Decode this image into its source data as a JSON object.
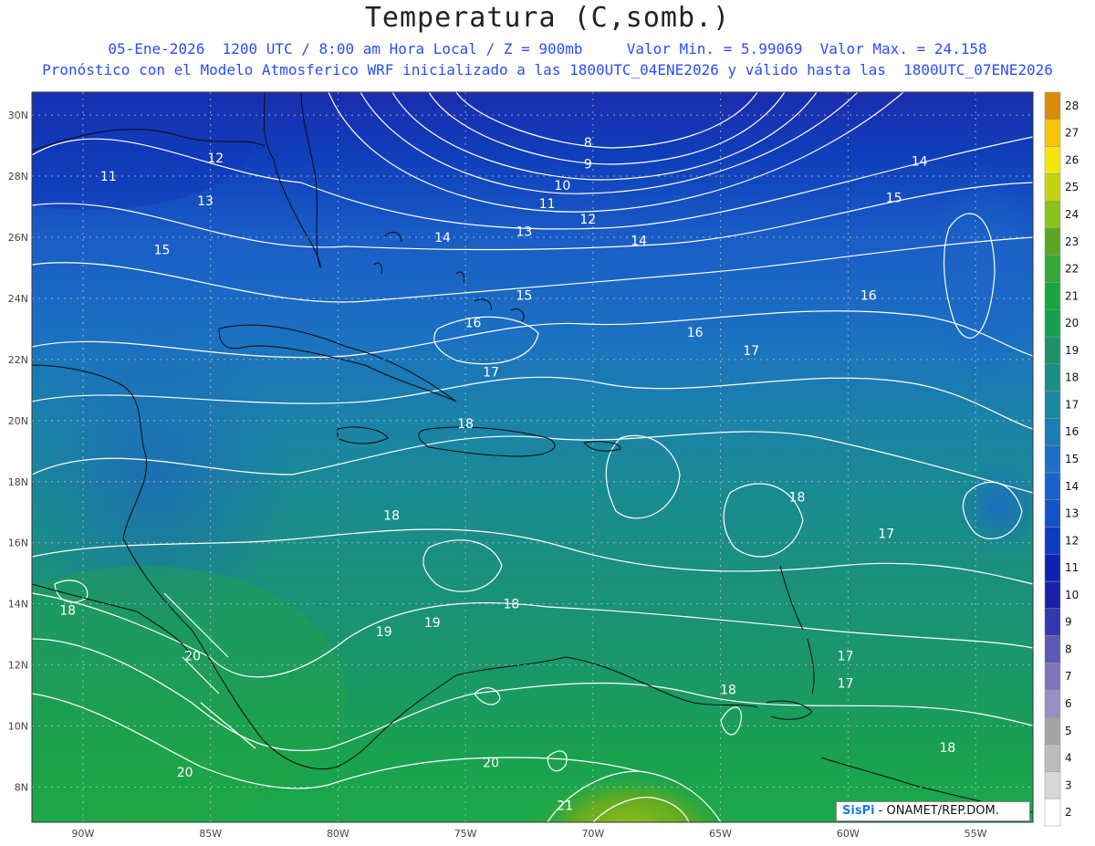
{
  "header": {
    "title": "Temperatura (C,somb.)",
    "line1": "05-Ene-2026  1200 UTC / 8:00 am Hora Local / Z = 900mb     Valor Min. = 5.99069  Valor Max. = 24.158",
    "line2": "Pronóstico con el Modelo Atmosferico WRF inicializado a las 1800UTC_04ENE2026 y válido hasta las  1800UTC_07ENE2026"
  },
  "map": {
    "lon_range": [
      -92,
      -52.75
    ],
    "lat_range": [
      6.85,
      30.75
    ],
    "lon_ticks": [
      {
        "value": -90,
        "label": "90W"
      },
      {
        "value": -85,
        "label": "85W"
      },
      {
        "value": -80,
        "label": "80W"
      },
      {
        "value": -75,
        "label": "75W"
      },
      {
        "value": -70,
        "label": "70W"
      },
      {
        "value": -65,
        "label": "65W"
      },
      {
        "value": -60,
        "label": "60W"
      },
      {
        "value": -55,
        "label": "55W"
      }
    ],
    "lat_ticks": [
      {
        "value": 30,
        "label": "30N"
      },
      {
        "value": 28,
        "label": "28N"
      },
      {
        "value": 26,
        "label": "26N"
      },
      {
        "value": 24,
        "label": "24N"
      },
      {
        "value": 22,
        "label": "22N"
      },
      {
        "value": 20,
        "label": "20N"
      },
      {
        "value": 18,
        "label": "18N"
      },
      {
        "value": 16,
        "label": "16N"
      },
      {
        "value": 14,
        "label": "14N"
      },
      {
        "value": 12,
        "label": "12N"
      },
      {
        "value": 10,
        "label": "10N"
      },
      {
        "value": 8,
        "label": "8N"
      }
    ],
    "contour_labels": [
      {
        "value": "8",
        "lon": -70.2,
        "lat": 29.1
      },
      {
        "value": "9",
        "lon": -70.2,
        "lat": 28.4
      },
      {
        "value": "10",
        "lon": -71.2,
        "lat": 27.7
      },
      {
        "value": "11",
        "lon": -71.8,
        "lat": 27.1
      },
      {
        "value": "12",
        "lon": -70.2,
        "lat": 26.6
      },
      {
        "value": "13",
        "lon": -72.7,
        "lat": 26.2
      },
      {
        "value": "14",
        "lon": -68.2,
        "lat": 25.9
      },
      {
        "value": "14",
        "lon": -75.9,
        "lat": 26.0
      },
      {
        "value": "11",
        "lon": -89.0,
        "lat": 28.0
      },
      {
        "value": "12",
        "lon": -84.8,
        "lat": 28.6
      },
      {
        "value": "13",
        "lon": -85.2,
        "lat": 27.2
      },
      {
        "value": "15",
        "lon": -86.9,
        "lat": 25.6
      },
      {
        "value": "14",
        "lon": -57.2,
        "lat": 28.5
      },
      {
        "value": "15",
        "lon": -58.2,
        "lat": 27.3
      },
      {
        "value": "15",
        "lon": -72.7,
        "lat": 24.1
      },
      {
        "value": "16",
        "lon": -74.7,
        "lat": 23.2
      },
      {
        "value": "16",
        "lon": -66.0,
        "lat": 22.9
      },
      {
        "value": "16",
        "lon": -59.2,
        "lat": 24.1
      },
      {
        "value": "17",
        "lon": -63.8,
        "lat": 22.3
      },
      {
        "value": "17",
        "lon": -74.0,
        "lat": 21.6
      },
      {
        "value": "18",
        "lon": -75.0,
        "lat": 19.9
      },
      {
        "value": "18",
        "lon": -77.9,
        "lat": 16.9
      },
      {
        "value": "18",
        "lon": -62.0,
        "lat": 17.5
      },
      {
        "value": "17",
        "lon": -58.5,
        "lat": 16.3
      },
      {
        "value": "18",
        "lon": -90.6,
        "lat": 13.8
      },
      {
        "value": "18",
        "lon": -73.2,
        "lat": 14.0
      },
      {
        "value": "19",
        "lon": -78.2,
        "lat": 13.1
      },
      {
        "value": "19",
        "lon": -76.3,
        "lat": 13.4
      },
      {
        "value": "20",
        "lon": -85.7,
        "lat": 12.3
      },
      {
        "value": "17",
        "lon": -60.1,
        "lat": 12.3
      },
      {
        "value": "17",
        "lon": -60.1,
        "lat": 11.4
      },
      {
        "value": "18",
        "lon": -64.7,
        "lat": 11.2
      },
      {
        "value": "18",
        "lon": -56.1,
        "lat": 9.3
      },
      {
        "value": "20",
        "lon": -74.0,
        "lat": 8.8
      },
      {
        "value": "20",
        "lon": -86.0,
        "lat": 8.5
      },
      {
        "value": "21",
        "lon": -71.1,
        "lat": 7.4
      }
    ]
  },
  "colorbar": {
    "levels": [
      "2",
      "3",
      "4",
      "5",
      "6",
      "7",
      "8",
      "9",
      "10",
      "11",
      "12",
      "13",
      "14",
      "15",
      "16",
      "17",
      "18",
      "19",
      "20",
      "21",
      "22",
      "23",
      "24",
      "25",
      "26",
      "27",
      "28"
    ],
    "colors": [
      "#ffffff",
      "#d8d8d8",
      "#bcbcbc",
      "#a4a4a4",
      "#9a8ec4",
      "#7f75bd",
      "#5c59b4",
      "#3537ae",
      "#1b1fa8",
      "#0c22b2",
      "#0d3cbf",
      "#1452c7",
      "#1b63c9",
      "#1d70c5",
      "#1d7bb5",
      "#1b86a0",
      "#1a8d87",
      "#1a9268",
      "#16a04c",
      "#18a73e",
      "#36a839",
      "#5aa623",
      "#8bc21a",
      "#c8d30f",
      "#f2e60c",
      "#f6c405",
      "#d88c0c"
    ]
  },
  "credit": {
    "logo": "SisPi",
    "text": " - ONAMET/REP.DOM."
  }
}
